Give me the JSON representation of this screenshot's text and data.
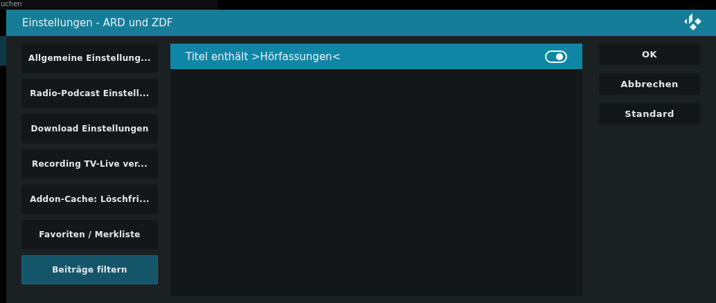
{
  "background": {
    "search_label": "uchen"
  },
  "window": {
    "title": "Einstellungen - ARD und ZDF"
  },
  "categories": [
    {
      "label": "Allgemeine Einstellung...",
      "selected": false
    },
    {
      "label": "Radio-Podcast Einstell...",
      "selected": false
    },
    {
      "label": "Download Einstellungen",
      "selected": false
    },
    {
      "label": "Recording TV-Live ver...",
      "selected": false
    },
    {
      "label": "Addon-Cache: Löschfri...",
      "selected": false
    },
    {
      "label": "Favoriten / Merkliste",
      "selected": false
    },
    {
      "label": "Beiträge filtern",
      "selected": true
    }
  ],
  "settings": [
    {
      "label": "Titel enthält >Hörfassungen<",
      "on": true,
      "selected": true
    }
  ],
  "buttons": [
    "OK",
    "Abbrechen",
    "Standard"
  ]
}
